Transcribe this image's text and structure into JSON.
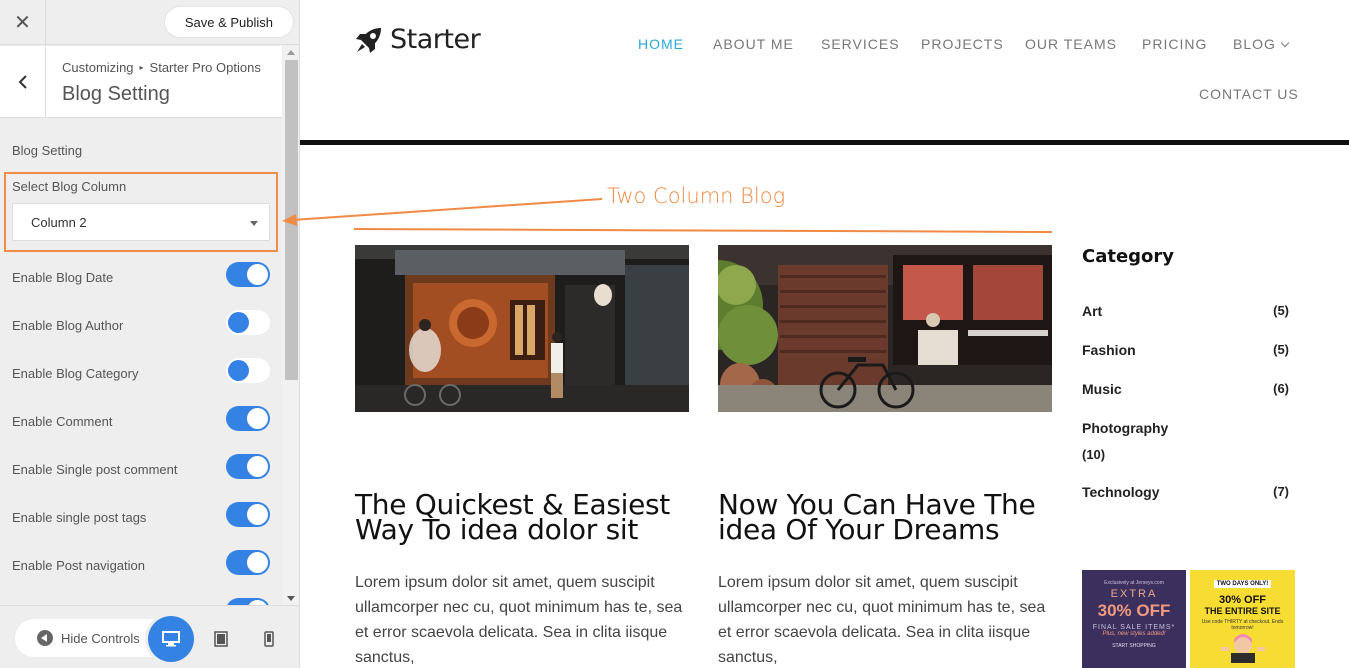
{
  "customizer": {
    "close_glyph": "✕",
    "save_label": "Save & Publish",
    "breadcrumb": [
      "Customizing",
      "Starter Pro Options"
    ],
    "breadcrumb_sep": "▸",
    "panel_title": "Blog Setting",
    "section_title": "Blog Setting",
    "blog_column": {
      "label": "Select Blog Column",
      "value": "Column 2"
    },
    "toggles": [
      {
        "label": "Enable Blog Date",
        "on": true
      },
      {
        "label": "Enable Blog Author",
        "on": false
      },
      {
        "label": "Enable Blog Category",
        "on": false
      },
      {
        "label": "Enable Comment",
        "on": true
      },
      {
        "label": "Enable Single post comment",
        "on": true
      },
      {
        "label": "Enable single post tags",
        "on": true
      },
      {
        "label": "Enable Post navigation",
        "on": true
      }
    ],
    "footer": {
      "hide_controls": "Hide Controls"
    },
    "accent_color": "#3582e5",
    "highlight_color": "#f08a44"
  },
  "preview": {
    "logo_text": "Starter",
    "nav": [
      "HOME",
      "ABOUT ME",
      "SERVICES",
      "PROJECTS",
      "OUR TEAMS",
      "PRICING",
      "BLOG",
      "CONTACT US"
    ],
    "nav_active_color": "#29a9d6",
    "callout": "Two Column Blog",
    "posts": [
      {
        "title": "The Quickest & Easiest Way To idea dolor sit",
        "excerpt": "Lorem ipsum dolor sit amet, quem suscipit ullamcorper nec cu, quot minimum has te, sea et error scaevola delicata. Sea in clita iisque sanctus,"
      },
      {
        "title": "Now You Can Have The idea Of Your Dreams",
        "excerpt": "Lorem ipsum dolor sit amet, quem suscipit ullamcorper nec cu, quot minimum has te, sea et error scaevola delicata. Sea in clita iisque sanctus,"
      }
    ],
    "category_heading": "Category",
    "categories": [
      {
        "name": "Art",
        "count": "(5)"
      },
      {
        "name": "Fashion",
        "count": "(5)"
      },
      {
        "name": "Music",
        "count": "(6)"
      },
      {
        "name": "Photography",
        "count": "(10)"
      },
      {
        "name": "Technology",
        "count": "(7)"
      }
    ],
    "ad": {
      "left_small": "Exclusively at Jerseys.com",
      "left_extra": "EXTRA",
      "left_big": "30% OFF",
      "left_line1": "FINAL SALE ITEMS*",
      "left_line2": "Plus, new styles added!",
      "left_cta": "START SHOPPING",
      "right_tag": "TWO DAYS ONLY!",
      "right_big": "30% OFF",
      "right_sub": "THE ENTIRE SITE",
      "right_small": "Use code THIRTY at checkout. Ends tomorrow!"
    }
  }
}
